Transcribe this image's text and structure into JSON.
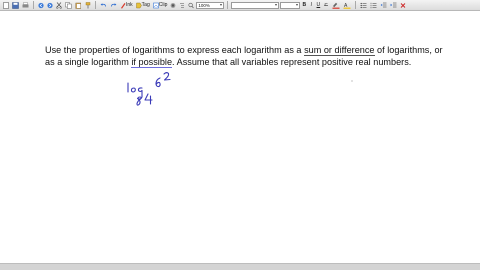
{
  "toolbar": {
    "ink_label": "Ink",
    "tag_label": "Tag",
    "clip_label": "Clip",
    "zoom_value": "100%",
    "font_value": "",
    "size_value": "",
    "bold_label": "B",
    "italic_label": "I",
    "underline_label": "U"
  },
  "problem": {
    "line1_a": "Use the properties of logarithms to express each logarithm as a ",
    "line1_link": "sum or difference",
    "line1_b": " of logarithms, or",
    "line2_a": "as a single logarithm ",
    "line2_link": "if possible",
    "line2_b": ". Assume that all variables represent positive real numbers."
  },
  "colors": {
    "ink": "#3b3bb8",
    "text": "#111111",
    "highlight_red": "#d93a2b",
    "highlight_yellow": "#f2c319"
  }
}
